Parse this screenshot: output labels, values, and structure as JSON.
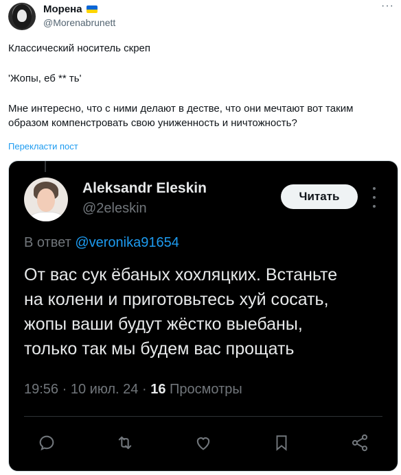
{
  "author": {
    "name": "Морена",
    "handle": "@Morenabrunett"
  },
  "tweet": {
    "paragraphs": [
      "Классический носитель скреп",
      "'Жопы, еб ** ть'",
      "Мне интересно, что с ними делают в дестве, что они мечтают вот таким образом компенстровать свою униженность и ничтожность?"
    ],
    "translate_label": "Перекласти пост"
  },
  "embedded": {
    "name": "Aleksandr Eleskin",
    "handle": "@2eleskin",
    "follow_label": "Читать",
    "reply_prefix": "В ответ",
    "reply_mention": "@veronika91654",
    "text": "От вас сук ёбаных хохляцких. Встаньте\nна колени и приготовьтесь хуй сосать,\nжопы ваши будут жёстко выебаны,\nтолько так мы будем вас прощать",
    "time": "19:56",
    "date": "10 июл. 24",
    "views_count": "16",
    "views_label": "Просмотры"
  },
  "colors": {
    "accent": "#1d9bf0",
    "dark_bg": "#000000",
    "flag_blue": "#0a66d6",
    "flag_yellow": "#ffd500"
  },
  "icons": [
    "more-icon",
    "flag-icon",
    "reply-icon",
    "retweet-icon",
    "like-icon",
    "bookmark-icon",
    "share-icon"
  ]
}
